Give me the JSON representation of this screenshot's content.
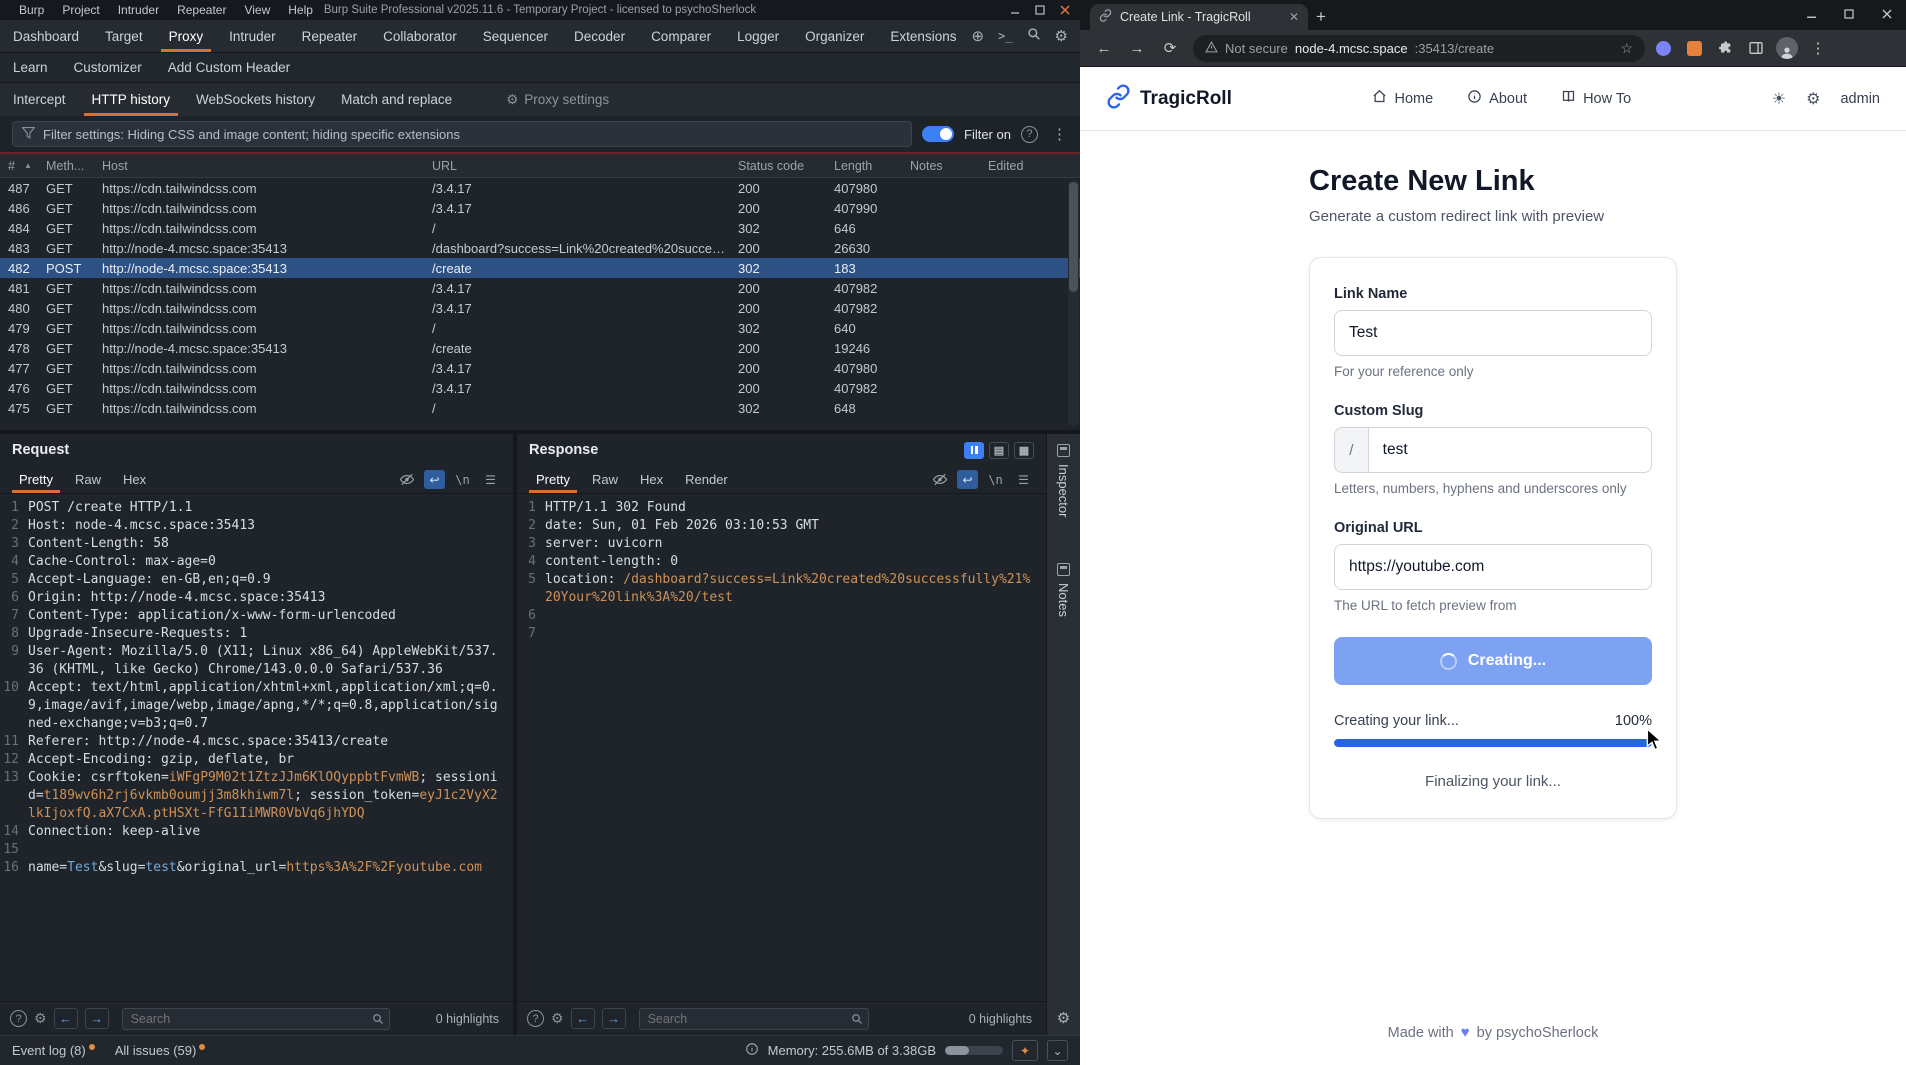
{
  "icons": {
    "gear": "⚙",
    "kebab": "⋮",
    "hamburger": "☰",
    "question": "?",
    "plus": "+",
    "chevron_down": "⌄",
    "newline": "\\n",
    "terminal": ">_",
    "globe": "⊕",
    "back_arrow": "←",
    "forward_arrow": "→",
    "reload": "⟳",
    "star": "☆",
    "close": "✕",
    "wrap": "↩",
    "layout_rows": "▤",
    "layout_grid": "▦",
    "sun": "☀",
    "sparkle": "✦",
    "sort_asc": "▲",
    "heart": "♥"
  },
  "burp": {
    "menu": [
      "Burp",
      "Project",
      "Intruder",
      "Repeater",
      "View",
      "Help"
    ],
    "window_title": "Burp Suite Professional v2025.11.6 - Temporary Project - licensed to psychoSherlock",
    "main_tabs": [
      {
        "label": "Dashboard"
      },
      {
        "label": "Target"
      },
      {
        "label": "Proxy",
        "active": true
      },
      {
        "label": "Intruder"
      },
      {
        "label": "Repeater"
      },
      {
        "label": "Collaborator"
      },
      {
        "label": "Sequencer"
      },
      {
        "label": "Decoder"
      },
      {
        "label": "Comparer"
      },
      {
        "label": "Logger"
      },
      {
        "label": "Organizer"
      },
      {
        "label": "Extensions"
      }
    ],
    "secondary_tabs": [
      {
        "label": "Learn"
      },
      {
        "label": "Customizer"
      },
      {
        "label": "Add Custom Header"
      }
    ],
    "proxy_tabs": [
      {
        "label": "Intercept"
      },
      {
        "label": "HTTP history",
        "active": true
      },
      {
        "label": "WebSockets history"
      },
      {
        "label": "Match and replace"
      }
    ],
    "proxy_settings_label": "Proxy settings",
    "filter": {
      "summary": "Filter settings: Hiding CSS and image content; hiding specific extensions",
      "toggle_label": "Filter on"
    },
    "history": {
      "columns": [
        "#",
        "Meth...",
        "Host",
        "URL",
        "Status code",
        "Length",
        "Notes",
        "Edited"
      ],
      "rows": [
        {
          "id": "487",
          "method": "GET",
          "host": "https://cdn.tailwindcss.com",
          "url": "/3.4.17",
          "status": "200",
          "length": "407980",
          "notes": "",
          "edited": ""
        },
        {
          "id": "486",
          "method": "GET",
          "host": "https://cdn.tailwindcss.com",
          "url": "/3.4.17",
          "status": "200",
          "length": "407990",
          "notes": "",
          "edited": ""
        },
        {
          "id": "484",
          "method": "GET",
          "host": "https://cdn.tailwindcss.com",
          "url": "/",
          "status": "302",
          "length": "646",
          "notes": "",
          "edited": ""
        },
        {
          "id": "483",
          "method": "GET",
          "host": "http://node-4.mcsc.space:35413",
          "url": "/dashboard?success=Link%20created%20success...",
          "status": "200",
          "length": "26630",
          "notes": "",
          "edited": ""
        },
        {
          "id": "482",
          "method": "POST",
          "host": "http://node-4.mcsc.space:35413",
          "url": "/create",
          "status": "302",
          "length": "183",
          "notes": "",
          "edited": "",
          "selected": true
        },
        {
          "id": "481",
          "method": "GET",
          "host": "https://cdn.tailwindcss.com",
          "url": "/3.4.17",
          "status": "200",
          "length": "407982",
          "notes": "",
          "edited": ""
        },
        {
          "id": "480",
          "method": "GET",
          "host": "https://cdn.tailwindcss.com",
          "url": "/3.4.17",
          "status": "200",
          "length": "407982",
          "notes": "",
          "edited": ""
        },
        {
          "id": "479",
          "method": "GET",
          "host": "https://cdn.tailwindcss.com",
          "url": "/",
          "status": "302",
          "length": "640",
          "notes": "",
          "edited": ""
        },
        {
          "id": "478",
          "method": "GET",
          "host": "http://node-4.mcsc.space:35413",
          "url": "/create",
          "status": "200",
          "length": "19246",
          "notes": "",
          "edited": ""
        },
        {
          "id": "477",
          "method": "GET",
          "host": "https://cdn.tailwindcss.com",
          "url": "/3.4.17",
          "status": "200",
          "length": "407980",
          "notes": "",
          "edited": ""
        },
        {
          "id": "476",
          "method": "GET",
          "host": "https://cdn.tailwindcss.com",
          "url": "/3.4.17",
          "status": "200",
          "length": "407982",
          "notes": "",
          "edited": ""
        },
        {
          "id": "475",
          "method": "GET",
          "host": "https://cdn.tailwindcss.com",
          "url": "/",
          "status": "302",
          "length": "648",
          "notes": "",
          "edited": ""
        }
      ]
    },
    "request": {
      "title": "Request",
      "tabs": [
        {
          "label": "Pretty",
          "active": true
        },
        {
          "label": "Raw"
        },
        {
          "label": "Hex"
        }
      ],
      "search_placeholder": "Search",
      "highlights": "0 highlights",
      "lines": [
        {
          "n": "1",
          "seg": [
            {
              "t": "POST /create HTTP/1.1"
            }
          ]
        },
        {
          "n": "2",
          "seg": [
            {
              "t": "Host: node-4.mcsc.space:35413"
            }
          ]
        },
        {
          "n": "3",
          "seg": [
            {
              "t": "Content-Length: 58"
            }
          ]
        },
        {
          "n": "4",
          "seg": [
            {
              "t": "Cache-Control: max-age=0"
            }
          ]
        },
        {
          "n": "5",
          "seg": [
            {
              "t": "Accept-Language: en-GB,en;q=0.9"
            }
          ]
        },
        {
          "n": "6",
          "seg": [
            {
              "t": "Origin: http://node-4.mcsc.space:35413"
            }
          ]
        },
        {
          "n": "7",
          "seg": [
            {
              "t": "Content-Type: application/x-www-form-urlencoded"
            }
          ]
        },
        {
          "n": "8",
          "seg": [
            {
              "t": "Upgrade-Insecure-Requests: 1"
            }
          ]
        },
        {
          "n": "9",
          "seg": [
            {
              "t": "User-Agent: Mozilla/5.0 (X11; Linux x86_64) AppleWebKit/537.36 (KHTML, like Gecko) Chrome/143.0.0.0 Safari/537.36"
            }
          ]
        },
        {
          "n": "10",
          "seg": [
            {
              "t": "Accept: text/html,application/xhtml+xml,application/xml;q=0.9,image/avif,image/webp,image/apng,*/*;q=0.8,application/signed-exchange;v=b3;q=0.7"
            }
          ]
        },
        {
          "n": "11",
          "seg": [
            {
              "t": "Referer: http://node-4.mcsc.space:35413/create"
            }
          ]
        },
        {
          "n": "12",
          "seg": [
            {
              "t": "Accept-Encoding: gzip, deflate, br"
            }
          ]
        },
        {
          "n": "13",
          "seg": [
            {
              "t": "Cookie: csrftoken="
            },
            {
              "t": "iWFgP9M02t1ZtzJJm6KlOQyppbtFvmWB",
              "c": "o"
            },
            {
              "t": "; sessionid="
            },
            {
              "t": "t189wv6h2rj6vkmb0oumjj3m8khiwm7l",
              "c": "o"
            },
            {
              "t": "; session_token="
            },
            {
              "t": "eyJ1c2VyX2lkIjoxfQ.aX7CxA.ptHSXt-FfG1IiMWR0VbVq6jhYDQ",
              "c": "o"
            }
          ]
        },
        {
          "n": "14",
          "seg": [
            {
              "t": "Connection: keep-alive"
            }
          ]
        },
        {
          "n": "15",
          "seg": [
            {
              "t": ""
            }
          ]
        },
        {
          "n": "16",
          "seg": [
            {
              "t": "name="
            },
            {
              "t": "Test",
              "c": "b"
            },
            {
              "t": "&slug="
            },
            {
              "t": "test",
              "c": "b"
            },
            {
              "t": "&original_url="
            },
            {
              "t": "https%3A%2F%2Fyoutube.com",
              "c": "o"
            }
          ]
        }
      ]
    },
    "response": {
      "title": "Response",
      "tabs": [
        {
          "label": "Pretty",
          "active": true
        },
        {
          "label": "Raw"
        },
        {
          "label": "Hex"
        },
        {
          "label": "Render"
        }
      ],
      "search_placeholder": "Search",
      "highlights": "0 highlights",
      "lines": [
        {
          "n": "1",
          "seg": [
            {
              "t": "HTTP/1.1 302 Found"
            }
          ]
        },
        {
          "n": "2",
          "seg": [
            {
              "t": "date: Sun, 01 Feb 2026 03:10:53 GMT"
            }
          ]
        },
        {
          "n": "3",
          "seg": [
            {
              "t": "server: uvicorn"
            }
          ]
        },
        {
          "n": "4",
          "seg": [
            {
              "t": "content-length: 0"
            }
          ]
        },
        {
          "n": "5",
          "seg": [
            {
              "t": "location: "
            },
            {
              "t": "/dashboard?success=Link%20created%20successfully%21%20Your%20link%3A%20/test",
              "c": "o"
            }
          ]
        },
        {
          "n": "6",
          "seg": [
            {
              "t": ""
            }
          ]
        },
        {
          "n": "7",
          "seg": [
            {
              "t": ""
            }
          ]
        }
      ]
    },
    "inspector_label": "Inspector",
    "notes_label": "Notes",
    "status": {
      "event_log": "Event log (8)",
      "all_issues": "All issues (59)",
      "memory": "Memory: 255.6MB of 3.38GB"
    }
  },
  "browser": {
    "tab_title": "Create Link - TragicRoll",
    "not_secure": "Not secure",
    "url_host": "node-4.mcsc.space",
    "url_rest": ":35413/create"
  },
  "page": {
    "brand": "TragicRoll",
    "nav": {
      "home": "Home",
      "about": "About",
      "howto": "How To"
    },
    "user": "admin",
    "heading": "Create New Link",
    "subheading": "Generate a custom redirect link with preview",
    "form": {
      "link_name": {
        "label": "Link Name",
        "value": "Test",
        "helper": "For your reference only"
      },
      "custom_slug": {
        "label": "Custom Slug",
        "prefix": "/",
        "value": "test",
        "helper": "Letters, numbers, hyphens and underscores only"
      },
      "original_url": {
        "label": "Original URL",
        "value": "https://youtube.com",
        "helper": "The URL to fetch preview from"
      },
      "submit_label": "Creating..."
    },
    "progress": {
      "label": "Creating your link...",
      "percent": "100%",
      "status": "Finalizing your link..."
    },
    "footer": {
      "prefix": "Made with",
      "suffix": "by psychoSherlock"
    }
  }
}
